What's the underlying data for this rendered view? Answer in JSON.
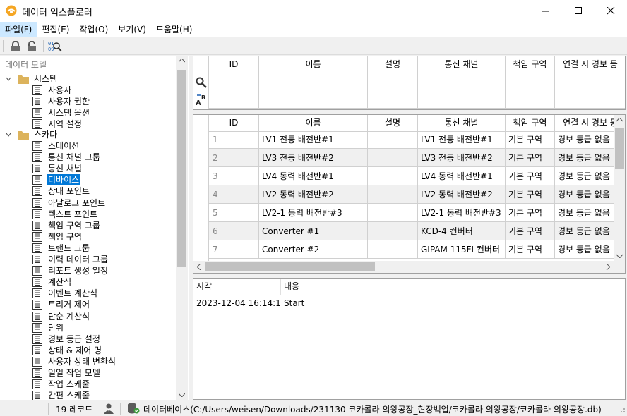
{
  "window": {
    "title": "데이터 익스플로러",
    "minimize_icon": "minimize-icon",
    "maximize_icon": "maximize-icon",
    "close_icon": "close-icon"
  },
  "menu": [
    {
      "label": "파일(F)"
    },
    {
      "label": "편집(E)"
    },
    {
      "label": "작업(O)"
    },
    {
      "label": "보기(V)"
    },
    {
      "label": "도움말(H)"
    }
  ],
  "toolbar": {
    "icons": [
      "lock-icon",
      "unlock-icon",
      "find-data-icon"
    ]
  },
  "tree": {
    "header": "데이터 모델",
    "groups": [
      {
        "label": "시스템",
        "items": [
          "사용자",
          "사용자 권한",
          "시스템 옵션",
          "지역 설정"
        ]
      },
      {
        "label": "스카다",
        "items": [
          "스테이션",
          "통신 채널 그룹",
          "통신 채널",
          "디바이스",
          "상태 포인트",
          "아날로그 포인트",
          "텍스트 포인트",
          "책임 구역 그룹",
          "책임 구역",
          "트랜드 그룹",
          "이력 데이터 그룹",
          "리포트 생성 일정",
          "계산식",
          "이벤트 계산식",
          "트리거 제어",
          "단순 계산식",
          "단위",
          "경보 등급 설정",
          "상태 & 제어 명",
          "사용자 상태 변환식",
          "일일 작업 모델",
          "작업 스케줄",
          "간편 스케줄"
        ]
      }
    ],
    "selected": "디바이스"
  },
  "grid": {
    "columns": [
      "ID",
      "이름",
      "설명",
      "통신 채널",
      "책임 구역",
      "연결 시 경보 등"
    ],
    "rows": [
      {
        "id": "1",
        "name": "LV1 전등 배전반#1",
        "desc": "",
        "channel": "LV1 전등 배전반#1",
        "area": "기본 구역",
        "alarm": "경보 등급 없음"
      },
      {
        "id": "2",
        "name": "LV3 전등 배전반#2",
        "desc": "",
        "channel": "LV3 전등 배전반#2",
        "area": "기본 구역",
        "alarm": "경보 등급 없음"
      },
      {
        "id": "3",
        "name": "LV4 동력 배전반#1",
        "desc": "",
        "channel": "LV4 동력 배전반#1",
        "area": "기본 구역",
        "alarm": "경보 등급 없음"
      },
      {
        "id": "4",
        "name": "LV2 동력 배전반#2",
        "desc": "",
        "channel": "LV2 동력 배전반#2",
        "area": "기본 구역",
        "alarm": "경보 등급 없음"
      },
      {
        "id": "5",
        "name": "LV2-1 동력 배전반#3",
        "desc": "",
        "channel": "LV2-1 동력 배전반#3",
        "area": "기본 구역",
        "alarm": "경보 등급 없음"
      },
      {
        "id": "6",
        "name": "Converter #1",
        "desc": "",
        "channel": "KCD-4 컨버터",
        "area": "기본 구역",
        "alarm": "경보 등급 없음"
      },
      {
        "id": "7",
        "name": "Converter #2",
        "desc": "",
        "channel": "GIPAM 115FI 컨버터",
        "area": "기본 구역",
        "alarm": "경보 등급 없음"
      }
    ]
  },
  "log": {
    "columns": [
      "시각",
      "내용"
    ],
    "rows": [
      {
        "time": "2023-12-04 16:14:18",
        "message": "Start"
      }
    ]
  },
  "status": {
    "record_count": "19 레코드",
    "database": "데이터베이스(C:/Users/weisen/Downloads/231130 코카콜라 의왕공장_현장백업/코카콜라 의왕공장/코카콜라 의왕공장.db)"
  }
}
